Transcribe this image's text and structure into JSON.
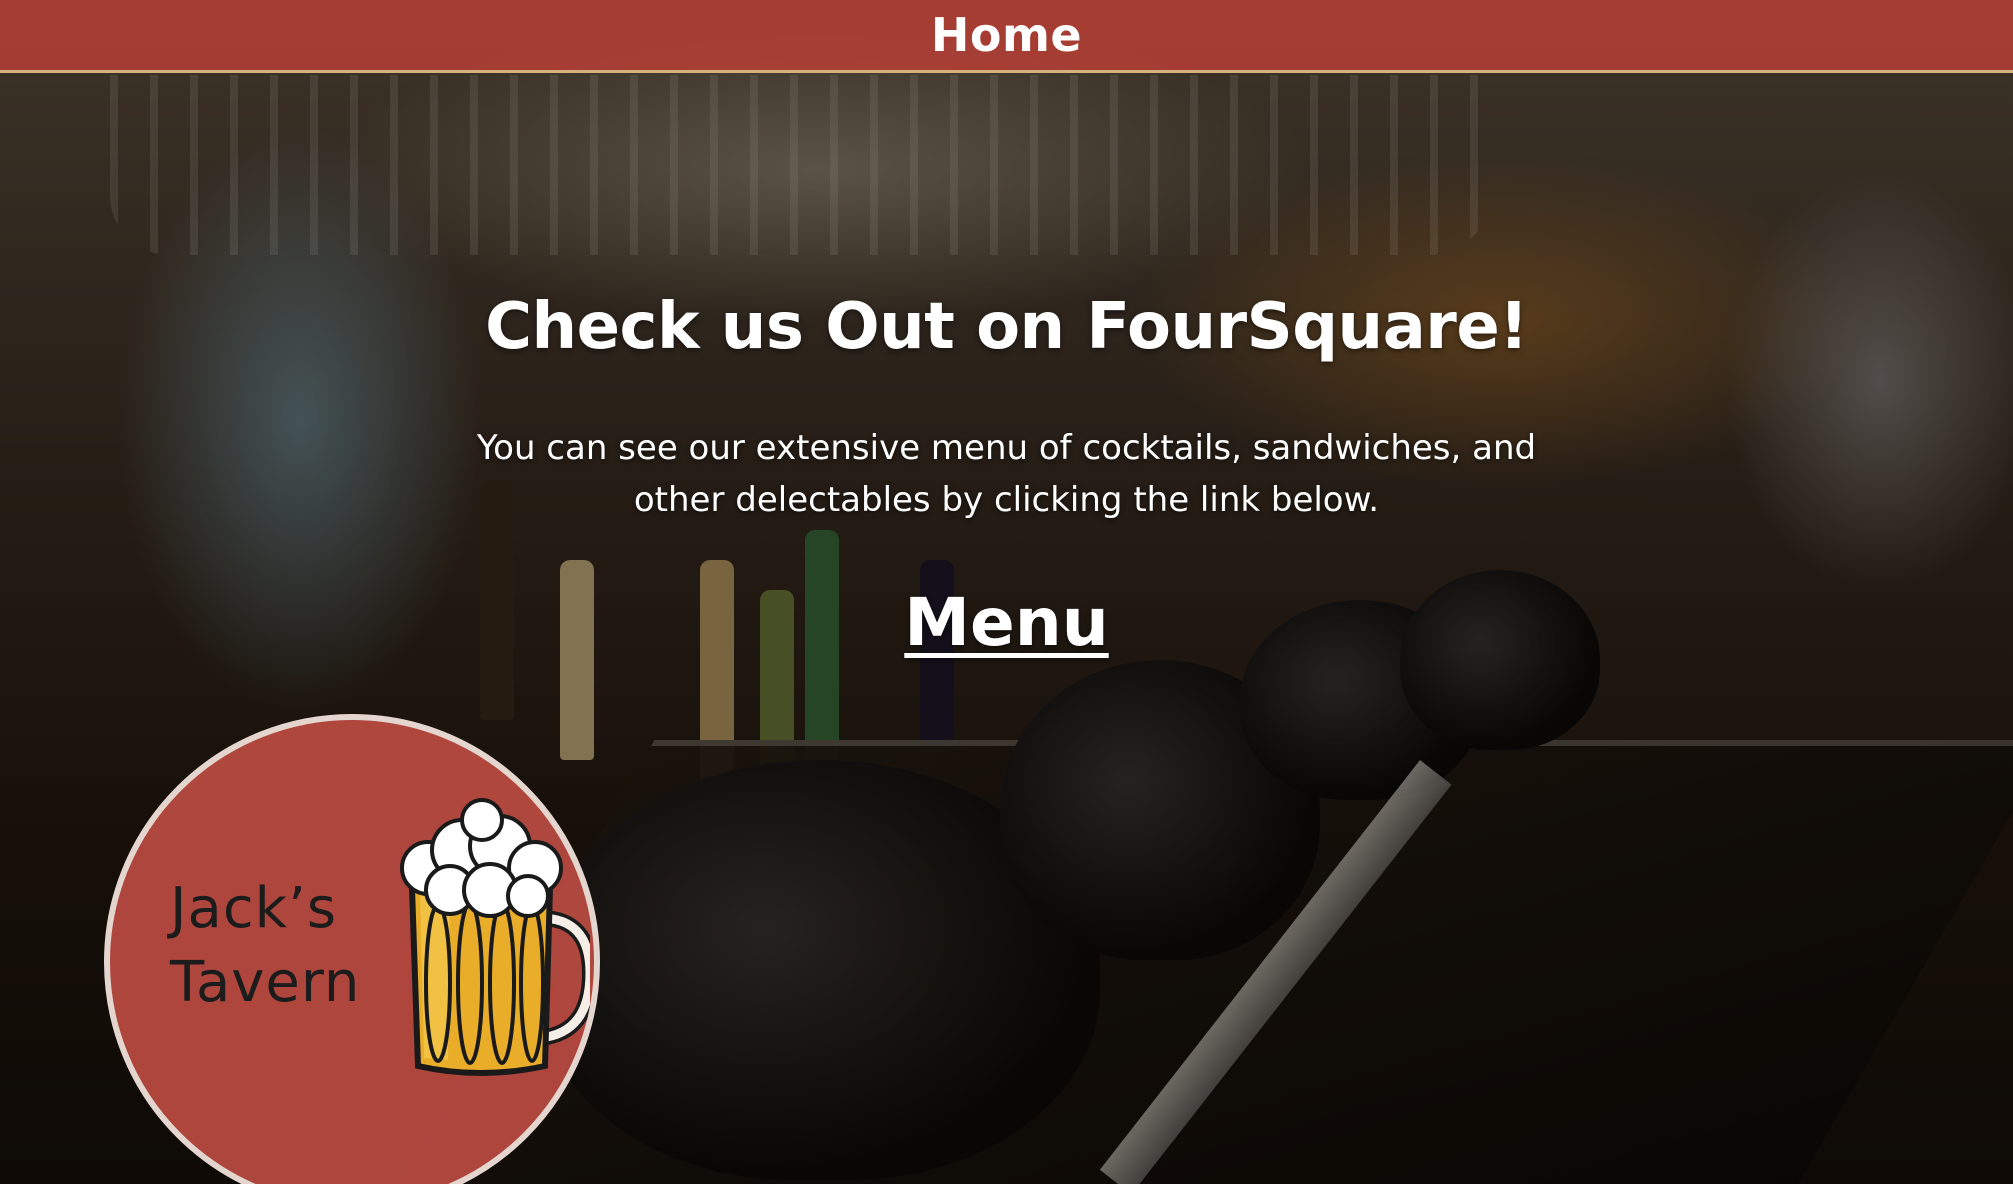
{
  "nav": {
    "home_label": "Home"
  },
  "main": {
    "heading": "Check us Out on FourSquare!",
    "description": "You can see our extensive menu of cocktails, sandwiches, and other delectables by clicking the link below.",
    "menu_link": "Menu"
  },
  "logo": {
    "line1": "Jack’s",
    "line2": "Tavern",
    "icon": "beer-mug-icon"
  },
  "colors": {
    "nav_background": "#bc4036",
    "nav_border": "#d8b27c",
    "logo_background": "#c44e44",
    "text": "#ffffff"
  }
}
